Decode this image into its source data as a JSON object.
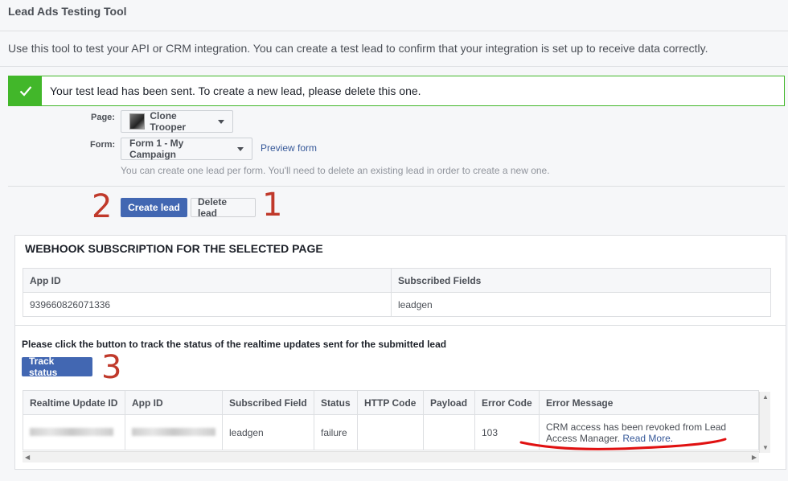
{
  "header": {
    "title": "Lead Ads Testing Tool",
    "description": "Use this tool to test your API or CRM integration. You can create a test lead to confirm that your integration is set up to receive data correctly."
  },
  "banner": {
    "message": "Your test lead has been sent. To create a new lead, please delete this one.",
    "icon": "checkmark-icon",
    "color": "#42b72a"
  },
  "form": {
    "page_label": "Page:",
    "page_value": "Clone Trooper",
    "form_label": "Form:",
    "form_value": "Form 1 - My Campaign",
    "preview_link": "Preview form",
    "hint": "You can create one lead per form. You'll need to delete an existing lead in order to create a new one."
  },
  "actions": {
    "create_label": "Create lead",
    "delete_label": "Delete lead",
    "annotation_create": "2",
    "annotation_delete": "1"
  },
  "webhook": {
    "title": "WEBHOOK SUBSCRIPTION FOR THE SELECTED PAGE",
    "columns": [
      "App ID",
      "Subscribed Fields"
    ],
    "rows": [
      [
        "939660826071336",
        "leadgen"
      ]
    ]
  },
  "tracking": {
    "instruction": "Please click the button to track the status of the realtime updates sent for the submitted lead",
    "button_label": "Track status",
    "annotation": "3",
    "columns": [
      "Realtime Update ID",
      "App ID",
      "Subscribed Field",
      "Status",
      "HTTP Code",
      "Payload",
      "Error Code",
      "Error Message"
    ],
    "row": {
      "subscribed_field": "leadgen",
      "status": "failure",
      "http_code": "",
      "payload": "",
      "error_code": "103",
      "error_message": "CRM access has been revoked from Lead Access Manager.",
      "read_more": "Read More."
    }
  },
  "colors": {
    "accent": "#4267b2",
    "link": "#365899",
    "annotation": "#c0392b"
  }
}
